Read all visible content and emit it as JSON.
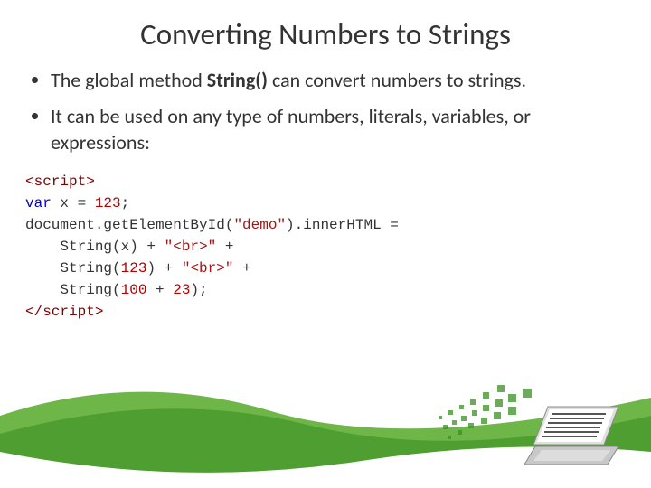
{
  "title": "Converting Numbers to Strings",
  "bullets": [
    {
      "pre": "The global method ",
      "bold": "String()",
      "post": " can convert numbers to strings."
    },
    {
      "pre": "It can be used on any type of numbers, literals, variables, or expressions:",
      "bold": "",
      "post": ""
    }
  ],
  "code": {
    "l1_open": "<script>",
    "l2_var": "var",
    "l2_rest": " x = ",
    "l2_num": "123",
    "l2_semi": ";",
    "l3_a": "document.getElementById(",
    "l3_str": "\"demo\"",
    "l3_b": ").innerHTML =",
    "l4_a": "    String(x) + ",
    "l4_str": "\"<br>\"",
    "l4_b": " +",
    "l5_a": "    String(",
    "l5_num": "123",
    "l5_b": ") + ",
    "l5_str": "\"<br>\"",
    "l5_c": " +",
    "l6_a": "    String(",
    "l6_num1": "100",
    "l6_plus": " + ",
    "l6_num2": "23",
    "l6_b": ");",
    "l7_close": "</script>"
  }
}
